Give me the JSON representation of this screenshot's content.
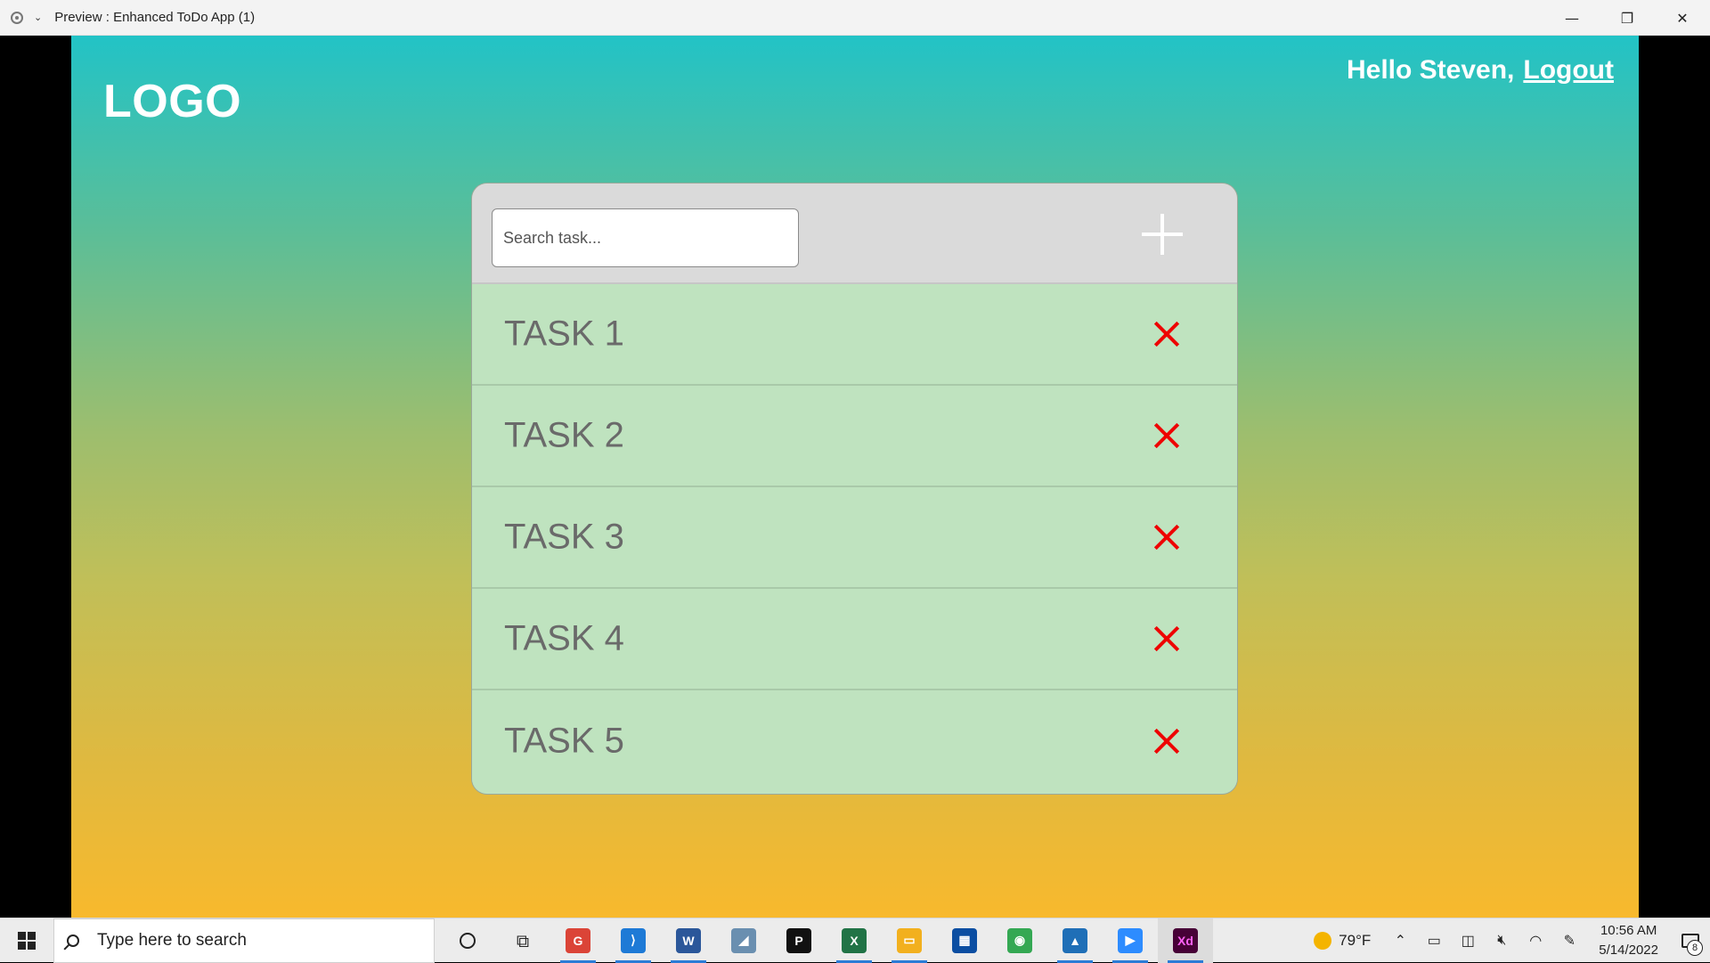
{
  "window": {
    "title": "Preview : Enhanced ToDo App (1)",
    "minimize_label": "—",
    "maximize_label": "❐",
    "close_label": "✕"
  },
  "header": {
    "logo": "LOGO",
    "greeting": "Hello Steven,",
    "logout_label": "Logout"
  },
  "todo": {
    "search_placeholder": "Search task...",
    "add_icon": "plus-icon",
    "tasks": [
      {
        "label": "TASK 1"
      },
      {
        "label": "TASK 2"
      },
      {
        "label": "TASK 3"
      },
      {
        "label": "TASK 4"
      },
      {
        "label": "TASK 5"
      }
    ],
    "delete_icon": "close-icon",
    "delete_color": "#e00000"
  },
  "taskbar": {
    "search_text": "Type here to search",
    "apps": [
      {
        "name": "chrome-profile",
        "letter": "G",
        "color": "#db4437"
      },
      {
        "name": "vscode",
        "letter": "⟩",
        "color": "#1e7ad6"
      },
      {
        "name": "word",
        "letter": "W",
        "color": "#2b579a"
      },
      {
        "name": "app-blue",
        "letter": "◢",
        "color": "#6a8fb0"
      },
      {
        "name": "jetbrains",
        "letter": "P",
        "color": "#111111"
      },
      {
        "name": "excel",
        "letter": "X",
        "color": "#217346"
      },
      {
        "name": "file-explorer",
        "letter": "▭",
        "color": "#f2b01e"
      },
      {
        "name": "store",
        "letter": "▦",
        "color": "#0b4ea2"
      },
      {
        "name": "chrome",
        "letter": "◉",
        "color": "#34a853"
      },
      {
        "name": "photos",
        "letter": "▲",
        "color": "#1f6fb7"
      },
      {
        "name": "zoom",
        "letter": "▶",
        "color": "#2d8cff"
      },
      {
        "name": "adobe-xd",
        "letter": "Xd",
        "color": "#470137"
      }
    ],
    "weather": "79°F",
    "time": "10:56 AM",
    "date": "5/14/2022",
    "notification_count": "8"
  }
}
